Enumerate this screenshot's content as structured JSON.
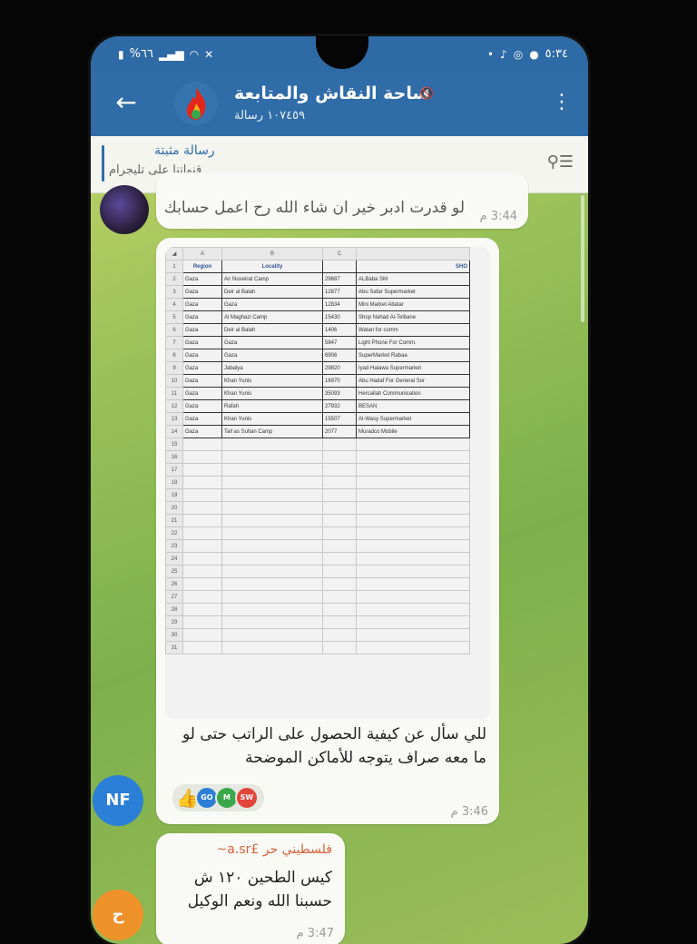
{
  "status_bar": {
    "battery": "%٦٦",
    "time": "٥:٣٤"
  },
  "header": {
    "channel_name": "ساحة النقاش والمتابعة",
    "message_count": "١٠٧٤٥٩ رسالة",
    "back_icon": "arrow-left-icon",
    "more_icon": "kebab-menu-icon"
  },
  "pinned": {
    "title": "رسالة مثبتة",
    "text": "قنواتنا على تليجرام"
  },
  "messages": [
    {
      "text": "لو قدرت ادبر خير ان شاء الله رح اعمل حسابك",
      "time": "3:44 م"
    },
    {
      "sheet": {
        "col_letters": [
          "A",
          "B",
          "C"
        ],
        "header_row": [
          "Region",
          "Locality",
          "",
          "SHO"
        ],
        "rows": [
          [
            "Gaza",
            "An Nuseirat Camp",
            "29687",
            "ALBaba SM"
          ],
          [
            "Gaza",
            "Deir al Balah",
            "12877",
            "Abu Safar Supermarket"
          ],
          [
            "Gaza",
            "Gaza",
            "12834",
            "Mini Market Altatar"
          ],
          [
            "Gaza",
            "Al Maghazi Camp",
            "15430",
            "Shop Nahad Al-Telbane"
          ],
          [
            "Gaza",
            "Deir al Balah",
            "1406",
            "Watan for comm"
          ],
          [
            "Gaza",
            "Gaza",
            "5847",
            "Light Phone For Comm."
          ],
          [
            "Gaza",
            "Gaza",
            "6906",
            "SuperMarket Rabaa"
          ],
          [
            "Gaza",
            "Jabalya",
            "29820",
            "Iyad Halawa Supermarket"
          ],
          [
            "Gaza",
            "Khan Yunis",
            "16970",
            "Abu Hadaf For General Sor"
          ],
          [
            "Gaza",
            "Khan Yunis",
            "35093",
            "Hercallah Communication"
          ],
          [
            "Gaza",
            "Rafah",
            "27932",
            "BESAN"
          ],
          [
            "Gaza",
            "Khan Yunis",
            "15507",
            "Al-Wasy Supermarket"
          ],
          [
            "Gaza",
            "Tall as Sultan Camp",
            "2077",
            "Muradco Mobile"
          ]
        ],
        "row_numbers": [
          "1",
          "2",
          "3",
          "4",
          "5",
          "6",
          "7",
          "8",
          "9",
          "10",
          "11",
          "12",
          "13",
          "14",
          "15",
          "16",
          "17",
          "18",
          "19",
          "20",
          "21",
          "22",
          "23",
          "24",
          "25",
          "26",
          "27",
          "28",
          "29",
          "30",
          "31"
        ]
      },
      "text": "للي سأل عن كيفية الحصول على الراتب حتى لو ما معه صراف يتوجه للأماكن الموضحة",
      "reactions": {
        "emoji": "👍",
        "avatars": [
          {
            "label": "GO",
            "color": "#2b7fd6"
          },
          {
            "label": "M",
            "color": "#3aa84a"
          },
          {
            "label": "SW",
            "color": "#e2453a"
          }
        ]
      },
      "time": "3:46 م",
      "avatar_initials": "NF"
    },
    {
      "sender": "فلسطيني حر £a.sr~",
      "text_line1": "كيس الطحين ١٢٠ ش",
      "text_line2": "حسبنا الله ونعم الوكيل",
      "time": "3:47 م",
      "avatar_initials": "ح"
    }
  ]
}
